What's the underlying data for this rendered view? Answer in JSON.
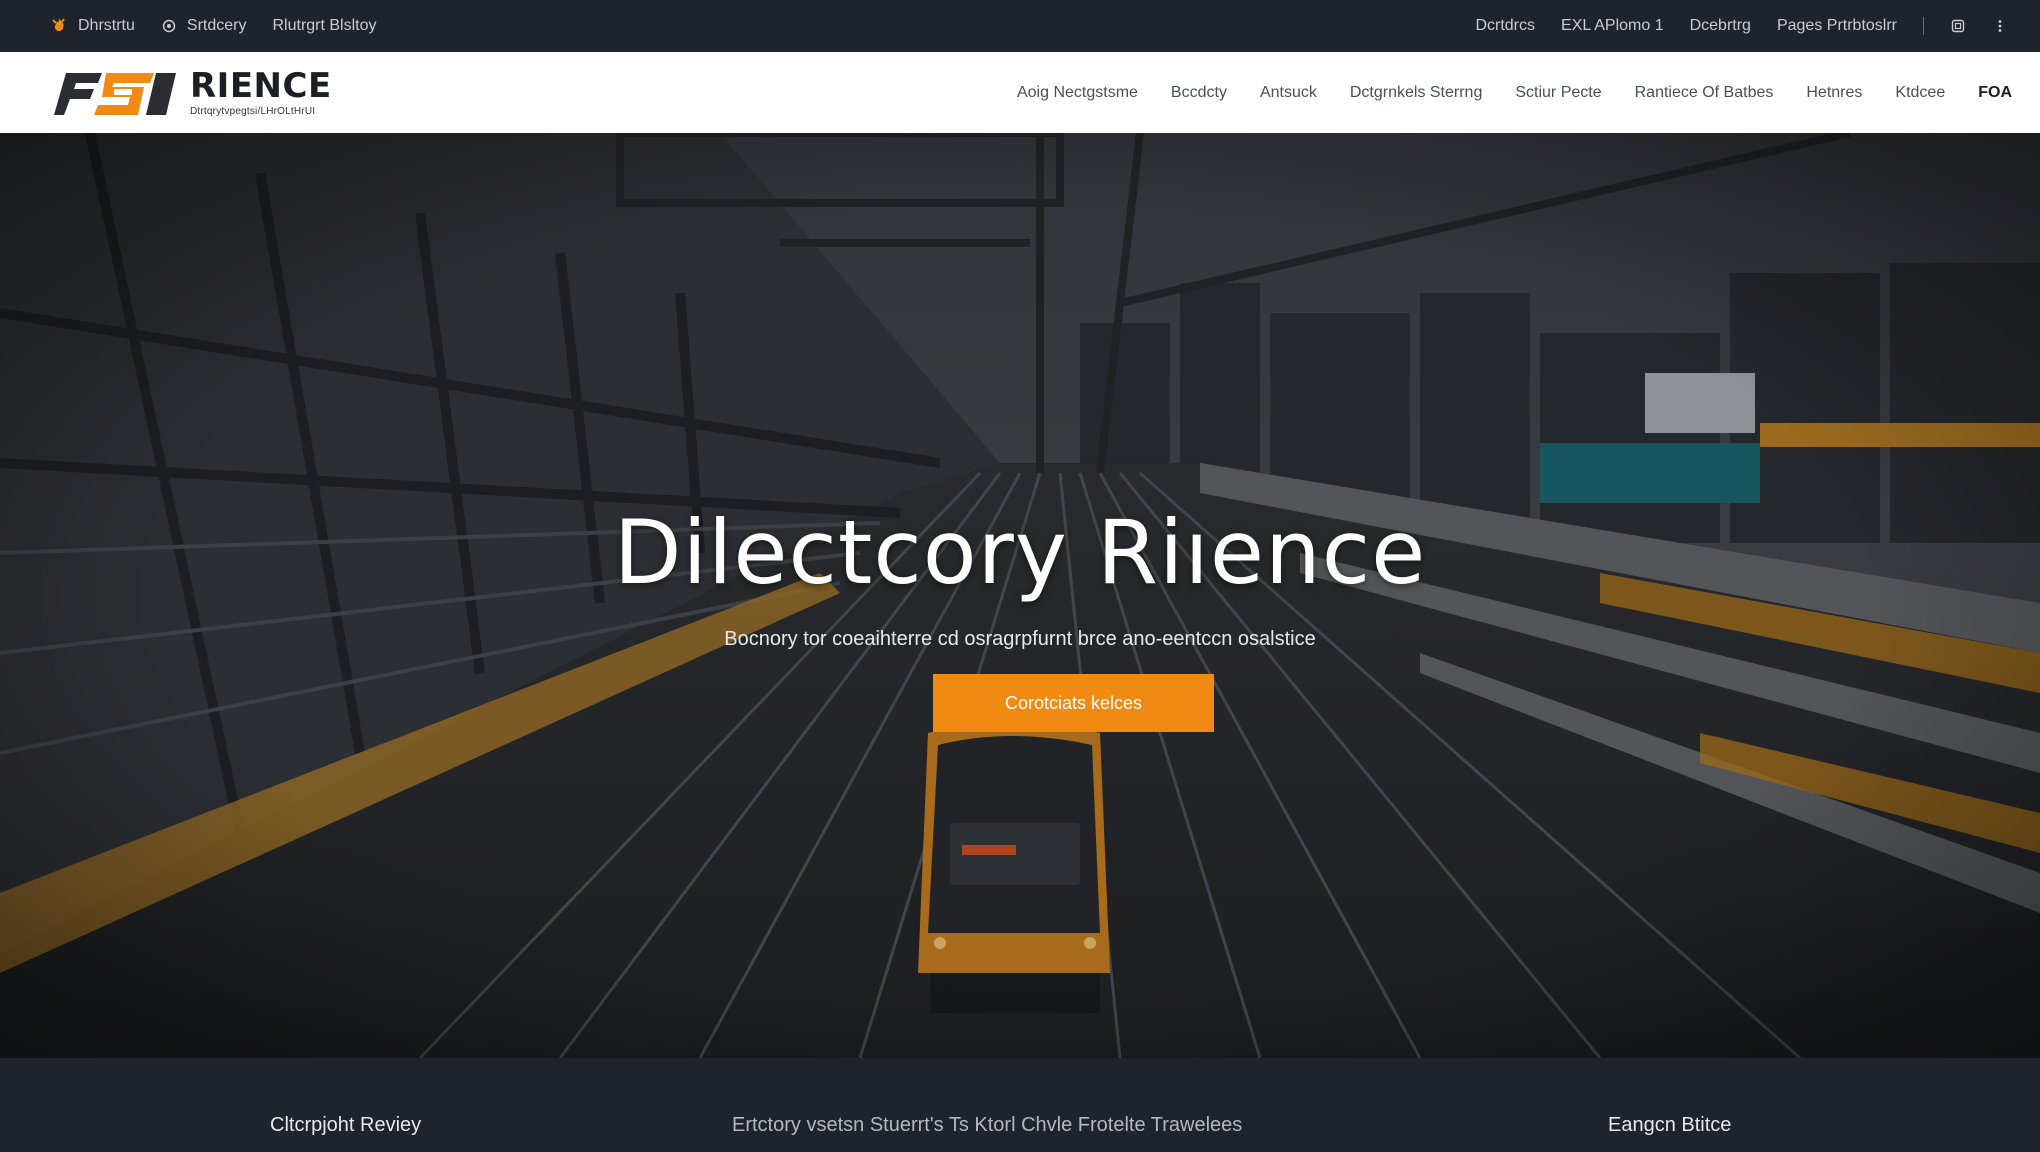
{
  "utility": {
    "left_items": [
      {
        "label": "Dhrstrtu",
        "icon": "flame-icon"
      },
      {
        "label": "Srtdcery",
        "icon": "pin-icon"
      },
      {
        "label": "Rlutrgrt Blsltoy",
        "icon": ""
      }
    ],
    "right_items": [
      "Dcrtdrcs",
      "EXL APlomo 1",
      "Dcebrtrg",
      "Pages Prtrbtoslrr"
    ],
    "right_icons": [
      "window-icon",
      "more-icon"
    ]
  },
  "header": {
    "logo_name": "RIENCE",
    "logo_tag": "Dtrtqrytvpegtsi/LHrOLtHrUI",
    "nav": [
      "Aoig Nectgstsme",
      "Bccdcty",
      "Antsuck",
      "Dctgrnkels Sterrng",
      "Sctiur Pecte",
      "Rantiece Of Batbes",
      "Hetnres",
      "Ktdcee",
      "FOA"
    ]
  },
  "hero": {
    "title": "Dilectcory Riıence",
    "subtitle": "Bocnory tor coeaihterre cd osragrpfurnt brce ano-eentccn osalstice",
    "cta": "Corotciats kelces"
  },
  "footer": {
    "items": [
      "Cltcrpjoht Reviey",
      "Ertctory vsetsn Stuerrt's Ts Ktorl Chvle Frotelte Trawelees",
      "Eangcn Btitce"
    ]
  },
  "colors": {
    "accent": "#f08a12",
    "dark_bar": "#1f232b",
    "header_bg": "#ffffff"
  }
}
